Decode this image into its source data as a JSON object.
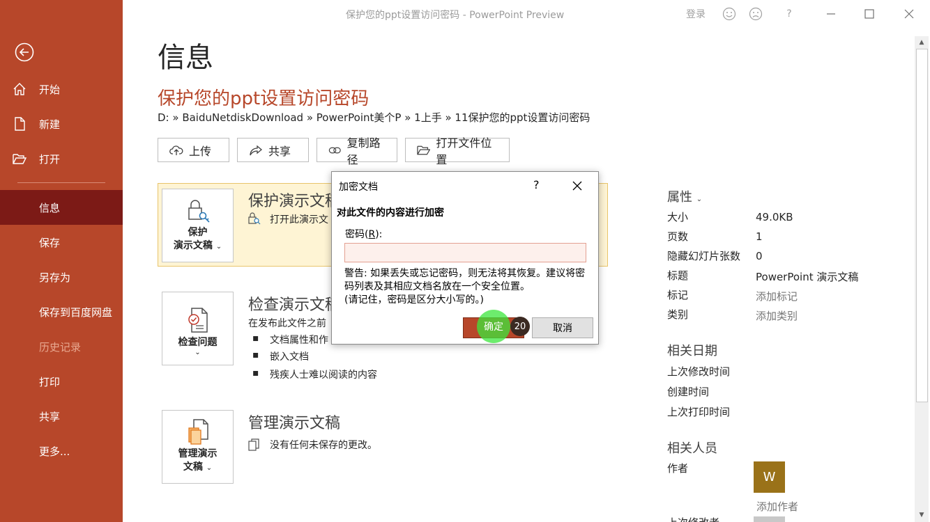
{
  "window": {
    "title": "保护您的ppt设置访问密码  -  PowerPoint Preview",
    "signin_label": "登录",
    "help_glyph": "?"
  },
  "sidebar": {
    "items": [
      {
        "label": "开始",
        "icon": "home-icon"
      },
      {
        "label": "新建",
        "icon": "new-document-icon"
      },
      {
        "label": "打开",
        "icon": "folder-open-icon"
      },
      {
        "label": "信息"
      },
      {
        "label": "保存"
      },
      {
        "label": "另存为"
      },
      {
        "label": "保存到百度网盘"
      },
      {
        "label": "历史记录"
      },
      {
        "label": "打印"
      },
      {
        "label": "共享"
      },
      {
        "label": "更多..."
      }
    ],
    "accent_color": "#b7472a",
    "active_color": "#7c1a16"
  },
  "main": {
    "page_title": "信息",
    "doc_title": "保护您的ppt设置访问密码",
    "breadcrumb": "D: » BaiduNetdiskDownload » PowerPoint美个P » 1上手 » 11保护您的ppt设置访问密码",
    "actions": [
      {
        "label": "上传",
        "icon": "upload-icon"
      },
      {
        "label": "共享",
        "icon": "share-icon"
      },
      {
        "label": "复制路径",
        "icon": "link-icon"
      },
      {
        "label": "打开文件位置",
        "icon": "folder-icon"
      }
    ],
    "protect": {
      "tile_line1": "保护",
      "tile_line2": "演示文稿",
      "title": "保护演示文稿",
      "desc": "打开此演示文"
    },
    "inspect": {
      "tile_label": "检查问题",
      "title": "检查演示文稿",
      "desc": "在发布此文件之前",
      "bullets": [
        "文档属性和作",
        "嵌入文档",
        "残疾人士难以阅读的内容"
      ]
    },
    "manage": {
      "tile_line1": "管理演示",
      "tile_line2": "文稿",
      "title": "管理演示文稿",
      "desc": "没有任何未保存的更改。"
    }
  },
  "properties": {
    "heading": "属性",
    "rows": [
      {
        "label": "大小",
        "value": "49.0KB"
      },
      {
        "label": "页数",
        "value": "1"
      },
      {
        "label": "隐藏幻灯片张数",
        "value": "0"
      },
      {
        "label": "标题",
        "value": "PowerPoint 演示文稿"
      },
      {
        "label": "标记",
        "value": "添加标记"
      },
      {
        "label": "类别",
        "value": "添加类别"
      }
    ],
    "dates_heading": "相关日期",
    "dates": [
      "上次修改时间",
      "创建时间",
      "上次打印时间"
    ],
    "people_heading": "相关人员",
    "author_label": "作者",
    "author_initial": "W",
    "add_author": "添加作者",
    "last_modified_by": "上次修改者"
  },
  "dialog": {
    "title": "加密文档",
    "help": "?",
    "heading": "对此文件的内容进行加密",
    "password_label_pre": "密码(",
    "password_label_key": "R",
    "password_label_post": "):",
    "password_value": "",
    "warning": "警告: 如果丢失或忘记密码，则无法将其恢复。建议将密码列表及其相应文档名放在一个安全位置。",
    "note": "(请记住，密码是区分大小写的。)",
    "ok_label": "确定",
    "cancel_label": "取消",
    "marker_count": "20"
  }
}
